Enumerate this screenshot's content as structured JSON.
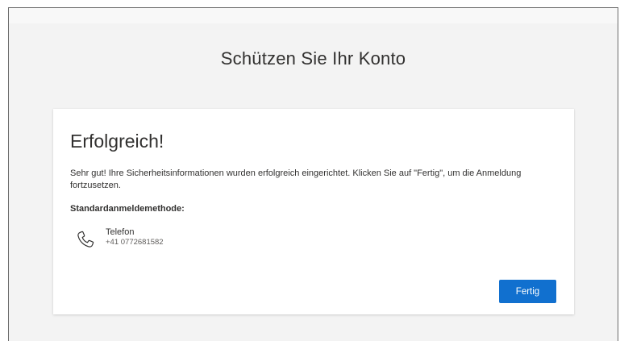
{
  "page": {
    "title": "Schützen Sie Ihr Konto"
  },
  "card": {
    "title": "Erfolgreich!",
    "message": "Sehr gut! Ihre Sicherheitsinformationen wurden erfolgreich eingerichtet. Klicken Sie auf \"Fertig\", um die Anmeldung fortzusetzen.",
    "method_label": "Standardanmeldemethode:",
    "method": {
      "icon": "phone-icon",
      "name": "Telefon",
      "number": "+41 0772681582"
    },
    "done_button": "Fertig"
  },
  "colors": {
    "accent": "#1170cf",
    "background": "#f3f3f3",
    "card": "#ffffff",
    "text": "#323130"
  }
}
